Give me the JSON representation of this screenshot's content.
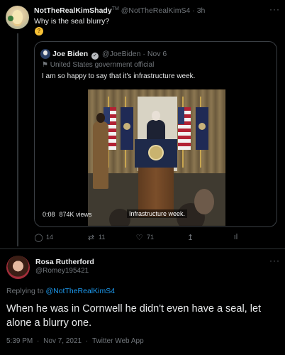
{
  "tweet1": {
    "name": "NotTheRealKimShady",
    "name_suffix": "TM",
    "handle": "@NotTheRealKimS4",
    "sep": "·",
    "time": "3h",
    "text": "Why is the seal blurry?",
    "emoji": "thinking-face-emoji",
    "more": "···",
    "quoted": {
      "name": "Joe Biden",
      "verified_icon": "verified-badge-icon",
      "handle": "@JoeBiden",
      "sep": "·",
      "date": "Nov 6",
      "label": "United States government official",
      "text": "I am so happy to say that it's infrastructure week.",
      "video": {
        "duration": "0:08",
        "views": "874K views",
        "caption": "Infrastructure week."
      }
    },
    "actions": {
      "reply": "14",
      "retweet": "11",
      "like": "71",
      "share": "",
      "analytics": ""
    }
  },
  "tweet2": {
    "name": "Rosa Rutherford",
    "handle": "@Romey195421",
    "more": "···",
    "replying_prefix": "Replying to",
    "replying_to": "@NotTheRealKimS4",
    "text": "When he was in Cornwell he didn't even have a seal, let alone a blurry one.",
    "time": "5:39 PM",
    "sep": "·",
    "date": "Nov 7, 2021",
    "sep2": "·",
    "source": "Twitter Web App"
  },
  "colors": {
    "background": "#000000",
    "text": "#e7e9ea",
    "muted": "#71767b",
    "link": "#1d9bf0",
    "border": "#2f3336"
  }
}
